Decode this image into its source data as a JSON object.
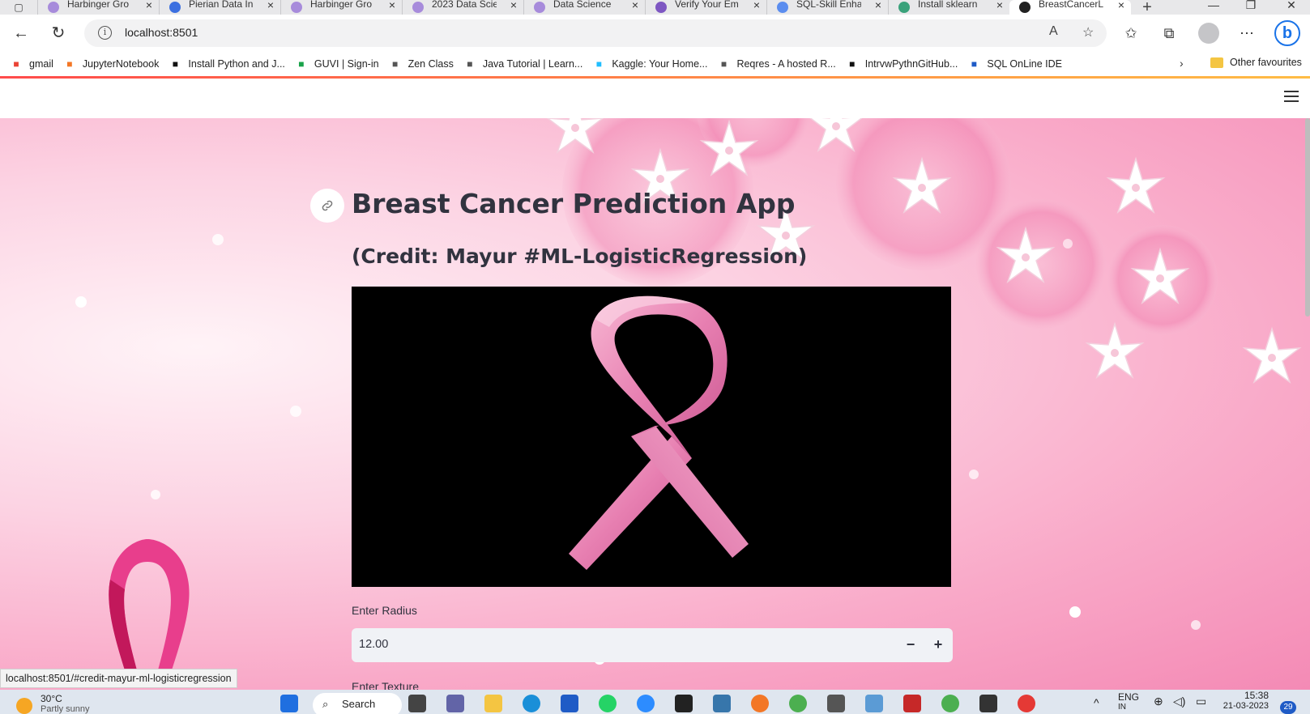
{
  "browser": {
    "tabs": [
      {
        "title": "Harbinger Gro",
        "favicon_color": "#a78bdb"
      },
      {
        "title": "Pierian Data In",
        "favicon_color": "#3b6fe0"
      },
      {
        "title": "Harbinger Gro",
        "favicon_color": "#a78bdb"
      },
      {
        "title": "2023 Data Scie",
        "favicon_color": "#a78bdb"
      },
      {
        "title": "Data Science",
        "favicon_color": "#a78bdb"
      },
      {
        "title": "Verify Your Em",
        "favicon_color": "#7e57c2"
      },
      {
        "title": "SQL-Skill Enha",
        "favicon_color": "#5b8def"
      },
      {
        "title": "Install sklearn",
        "favicon_color": "#3aa27b"
      },
      {
        "title": "BreastCancerL",
        "favicon_color": "#222222",
        "active": true
      }
    ],
    "address": "localhost:8501",
    "bookmarks": [
      {
        "label": "gmail",
        "icon": "gmail-icon"
      },
      {
        "label": "JupyterNotebook",
        "icon": "jupyter-icon"
      },
      {
        "label": "Install Python and J...",
        "icon": "video-icon"
      },
      {
        "label": "GUVI | Sign-in",
        "icon": "guvi-icon"
      },
      {
        "label": "Zen Class",
        "icon": "zen-icon"
      },
      {
        "label": "Java Tutorial | Learn...",
        "icon": "page-icon"
      },
      {
        "label": "Kaggle: Your Home...",
        "icon": "kaggle-icon"
      },
      {
        "label": "Reqres - A hosted R...",
        "icon": "page-icon"
      },
      {
        "label": "IntrvwPythnGitHub...",
        "icon": "github-icon"
      },
      {
        "label": "SQL OnLine IDE",
        "icon": "sql-icon"
      }
    ],
    "other_favourites": "Other favourites",
    "status_url": "localhost:8501/#credit-mayur-ml-logisticregression"
  },
  "app": {
    "title": "Breast Cancer Prediction App",
    "subtitle": "(Credit: Mayur #ML-LogisticRegression)",
    "radius_label": "Enter Radius",
    "radius_value": "12.00",
    "minus": "−",
    "plus": "+",
    "texture_label": "Enter Texture"
  },
  "taskbar": {
    "weather_temp": "30°C",
    "weather_desc": "Partly sunny",
    "search": "Search",
    "lang": "ENG",
    "lang_sub": "IN",
    "time": "15:38",
    "date": "21-03-2023",
    "notifications": "29"
  }
}
